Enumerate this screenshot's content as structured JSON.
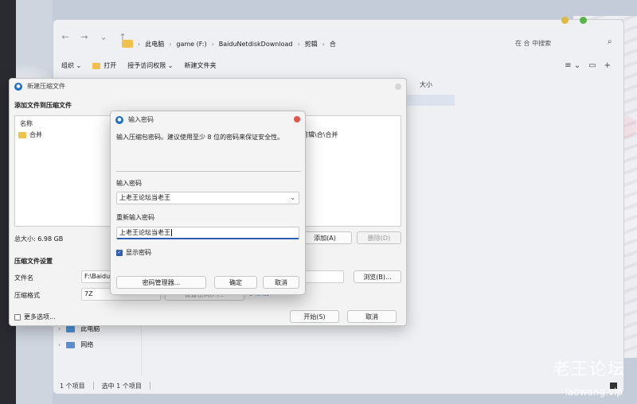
{
  "explorer": {
    "breadcrumb": [
      "此电脑",
      "game (F:)",
      "BaiduNetdiskDownload",
      "剪辑",
      "合"
    ],
    "search_placeholder": "在 合 中搜索",
    "toolbar": {
      "organize": "组织 ⌄",
      "open": "打开",
      "share": "授予访问权限 ⌄",
      "new_folder": "新建文件夹"
    },
    "column_size": "大小",
    "tree": [
      {
        "label": "此电脑"
      },
      {
        "label": "网络"
      }
    ],
    "status": {
      "count": "1 个项目",
      "selected": "选中 1 个项目"
    }
  },
  "archive": {
    "title": "新建压缩文件",
    "add_section": "添加文件到压缩文件",
    "list_header": "名称",
    "file_item": "合并",
    "file_path": "剪辑\\合\\合并",
    "total_size": "总大小: 6.98 GB",
    "add_button": "添加(A)",
    "remove_button": "删除(D)",
    "settings_section": "压缩文件设置",
    "filename_label": "文件名",
    "filename_value": "F:\\BaiduN",
    "browse_button": "浏览(B)...",
    "format_label": "压缩格式",
    "format_value": "7Z",
    "format_extra": "设置密码(P)...",
    "link_text": "[?帮助]",
    "more_options": "更多选项...",
    "start_button": "开始(S)",
    "cancel_button": "取消"
  },
  "password_dialog": {
    "title": "输入密码",
    "description": "输入压缩包密码。建议使用至少 8 位的密码来保证安全性。",
    "password_label": "输入密码",
    "password_value": "上老王论坛当老王",
    "repeat_label": "重新输入密码",
    "repeat_value": "上老王论坛当老王",
    "show_password": "显示密码",
    "manager_button": "密码管理器...",
    "ok_button": "确定",
    "cancel_button": "取消"
  },
  "watermark": {
    "chinese": "老王论坛",
    "url": "laowang.vip"
  },
  "colors": {
    "accent": "#2f5fb5",
    "close_red": "#e5534b",
    "folder": "#f2c14d"
  }
}
